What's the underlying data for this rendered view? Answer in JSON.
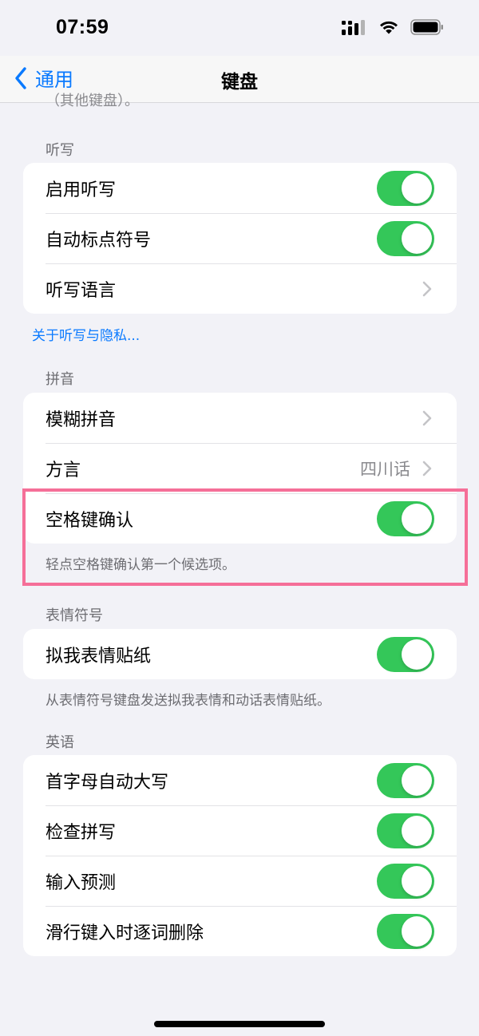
{
  "status_bar": {
    "time": "07:59",
    "icons": [
      "cellular-signal-icon",
      "wifi-icon",
      "battery-icon"
    ]
  },
  "nav": {
    "back_label": "通用",
    "title": "键盘"
  },
  "clipped_text": "（其他键盘）。",
  "sections": {
    "dictation": {
      "header": "听写",
      "rows": [
        {
          "label": "启用听写",
          "toggle": true
        },
        {
          "label": "自动标点符号",
          "toggle": true
        },
        {
          "label": "听写语言",
          "chevron": true
        }
      ],
      "link": "关于听写与隐私..."
    },
    "pinyin": {
      "header": "拼音",
      "rows": [
        {
          "label": "模糊拼音",
          "chevron": true
        },
        {
          "label": "方言",
          "value": "四川话",
          "chevron": true
        },
        {
          "label": "空格键确认",
          "toggle": true
        }
      ],
      "footer": "轻点空格键确认第一个候选项。"
    },
    "emoji": {
      "header": "表情符号",
      "rows": [
        {
          "label": "拟我表情贴纸",
          "toggle": true
        }
      ],
      "footer": "从表情符号键盘发送拟我表情和动话表情贴纸。"
    },
    "english": {
      "header": "英语",
      "rows": [
        {
          "label": "首字母自动大写",
          "toggle": true
        },
        {
          "label": "检查拼写",
          "toggle": true
        },
        {
          "label": "输入预测",
          "toggle": true
        },
        {
          "label": "滑行键入时逐词删除",
          "toggle": true
        }
      ]
    }
  },
  "colors": {
    "accent": "#0a7aff",
    "toggle_on": "#34c759",
    "highlight": "#f56f98",
    "background": "#f2f2f7"
  }
}
